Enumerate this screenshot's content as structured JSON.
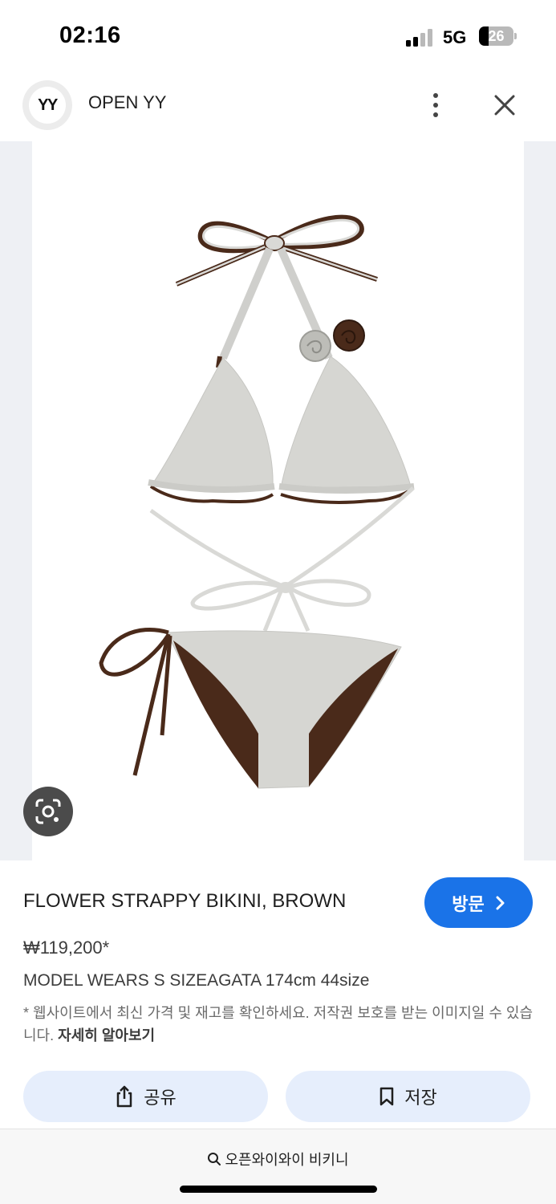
{
  "status_bar": {
    "time": "02:16",
    "network": "5G",
    "battery": "26",
    "icons": [
      "signal-icon",
      "battery-icon"
    ]
  },
  "header": {
    "site_logo_text": "YY",
    "site_name": "OPEN YY",
    "icons": [
      "more-vert-icon",
      "close-icon"
    ]
  },
  "image": {
    "icons": [
      "lens-icon"
    ],
    "colors": {
      "background": "#eef0f4",
      "fabric": "#d9d9d6",
      "trim": "#4a2a1a"
    }
  },
  "product": {
    "title": "FLOWER STRAPPY BIKINI, BROWN",
    "price": "₩119,200*",
    "description": "MODEL WEARS S SIZEAGATA 174cm 44size",
    "disclaimer": "* 웹사이트에서 최신 가격 및 재고를 확인하세요. 저작권 보호를 받는 이미지일 수 있습니다.",
    "learn_more": "자세히 알아보기"
  },
  "buttons": {
    "visit": "방문",
    "share": "공유",
    "save": "저장",
    "accent_color": "#1a73e8",
    "action_bg": "#e6eefc",
    "icons": [
      "chevron-right-icon",
      "share-icon",
      "bookmark-icon"
    ]
  },
  "bottom": {
    "query": "오픈와이와이 비키니",
    "icons": [
      "search-icon"
    ]
  }
}
